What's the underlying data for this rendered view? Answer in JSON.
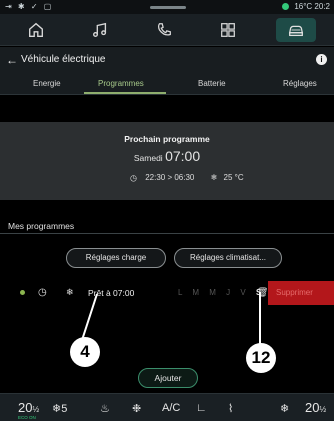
{
  "statusbar": {
    "left_icons": "⇥ ✱ ✓ ▢",
    "temperature": "16°C",
    "clock": "20:2"
  },
  "nav": {
    "items": [
      "home-icon",
      "music-icon",
      "phone-icon",
      "apps-icon",
      "car-icon"
    ],
    "active": "car-icon"
  },
  "titlebar": {
    "back": "←",
    "title": "Véhicule électrique",
    "info": "i"
  },
  "tabs": [
    {
      "label": "Energie"
    },
    {
      "label": "Programmes"
    },
    {
      "label": "Batterie"
    },
    {
      "label": "Réglages"
    }
  ],
  "next_program": {
    "heading": "Prochain programme",
    "day": "Samedi",
    "time": "07:00",
    "range": "22:30 > 06:30",
    "temp": "25 °C"
  },
  "section": {
    "title": "Mes programmes"
  },
  "buttons": {
    "charge": "Réglages charge",
    "climate": "Réglages climatisat...",
    "add": "Ajouter"
  },
  "program": {
    "ready": "Prêt à 07:00",
    "days_off": "L M M J V",
    "days_on": "S D",
    "delete": "Supprimer"
  },
  "callouts": {
    "a": "4",
    "b": "12"
  },
  "climate_bar": {
    "left_temp": "20",
    "left_temp_frac": "½",
    "fan": "5",
    "ac": "A/C",
    "right_temp": "20",
    "right_temp_frac": "½",
    "eco": "ECO ON"
  },
  "colors": {
    "accent": "#1e4b47",
    "active_tab": "#a7c98a",
    "delete": "#b3171b"
  }
}
